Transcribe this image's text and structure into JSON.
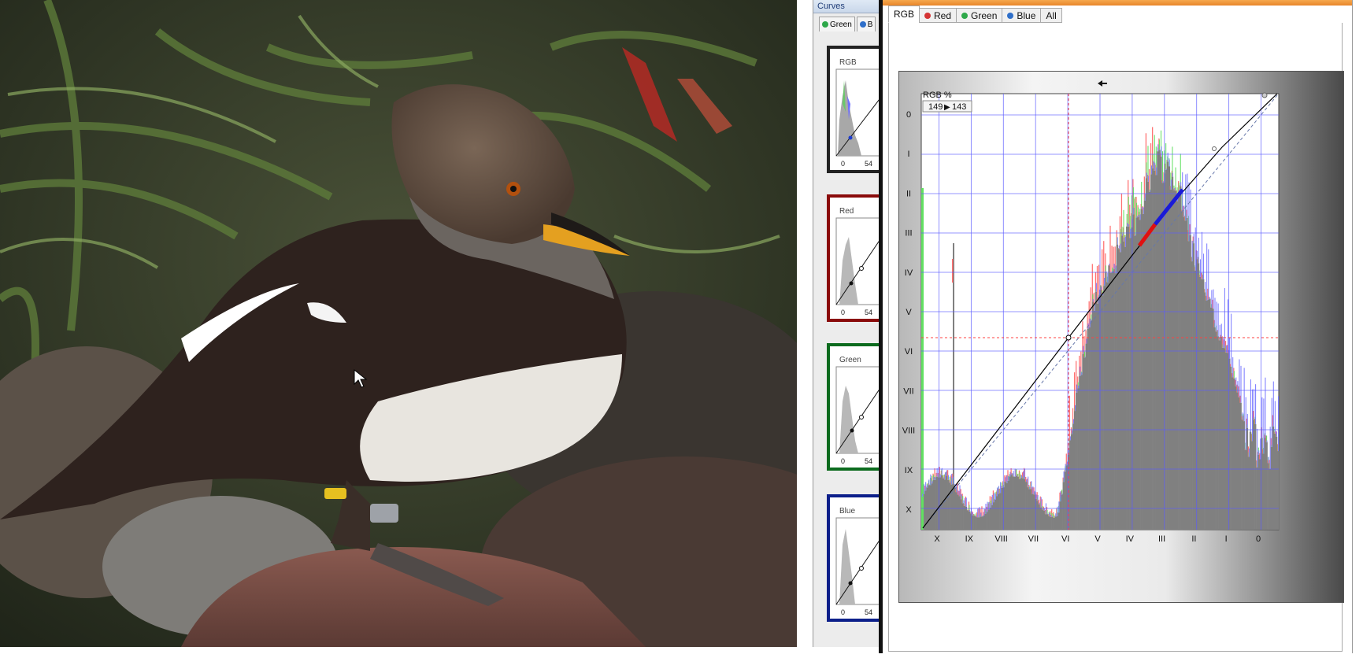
{
  "curves_small": {
    "title": "Curves",
    "tabs": [
      {
        "label": "Green",
        "color": "#2ea84a"
      },
      {
        "label": "B",
        "color": "#2f6fc9"
      }
    ],
    "panels": [
      {
        "label": "RGB",
        "border": "#222222",
        "tick0": "0",
        "tick54": "54"
      },
      {
        "label": "Red",
        "border": "#8a0b0b",
        "tick0": "0",
        "tick54": "54"
      },
      {
        "label": "Green",
        "border": "#0c6b1e",
        "tick0": "0",
        "tick54": "54"
      },
      {
        "label": "Blue",
        "border": "#0c1f8a",
        "tick0": "0",
        "tick54": "54"
      }
    ]
  },
  "curves_main": {
    "tabs": [
      {
        "label": "RGB",
        "active": true
      },
      {
        "label": "Red",
        "color": "#d43333"
      },
      {
        "label": "Green",
        "color": "#2ea84a"
      },
      {
        "label": "Blue",
        "color": "#2f6fc9"
      },
      {
        "label": "All"
      }
    ],
    "readout": {
      "channel": "RGB %",
      "input": "149",
      "output": "143",
      "arrow": "▶"
    },
    "y_ticks": [
      "0",
      "I",
      "II",
      "III",
      "IV",
      "V",
      "VI",
      "VII",
      "VIII",
      "IX",
      "X"
    ],
    "x_ticks": [
      "X",
      "IX",
      "VIII",
      "VII",
      "VI",
      "V",
      "IV",
      "III",
      "II",
      "I",
      "0"
    ]
  },
  "colors": {
    "grid": "#5b5bff",
    "histogram_gray": "#808080",
    "histogram_red": "#ff6f6f",
    "histogram_green": "#62e062",
    "histogram_blue": "#7d7dff",
    "curve": "#000000",
    "highlight_red": "#e01010",
    "highlight_blue": "#1a1ad8"
  }
}
